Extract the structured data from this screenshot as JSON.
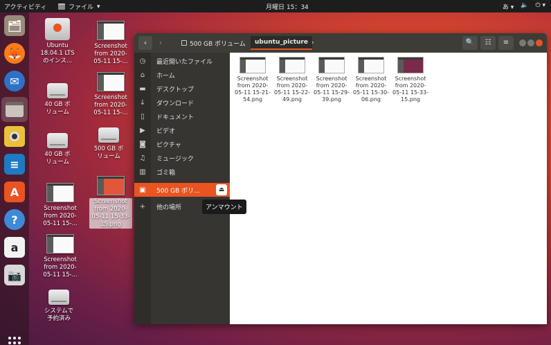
{
  "topbar": {
    "activities": "アクティビティ",
    "app_menu": "ファイル",
    "clock": "月曜日 15：34",
    "input_method": "あ",
    "volume_icon": "volume-icon",
    "power_icon": "power-icon"
  },
  "dock": {
    "items": [
      "files-icon",
      "firefox-icon",
      "thunderbird-icon",
      "nautilus-icon",
      "rhythmbox-icon",
      "writer-icon",
      "software-icon",
      "help-icon",
      "amazon-icon",
      "screenshot-icon"
    ]
  },
  "desktop": {
    "icons": [
      {
        "label": "Ubuntu\n18.04.1 LTS\nのインス..."
      },
      {
        "label": "40 GB ボ\nリューム"
      },
      {
        "label": "40 GB ボ\nリューム"
      },
      {
        "label": "Screenshot\nfrom 2020-\n05-11 15-..."
      },
      {
        "label": "Screenshot\nfrom 2020-\n05-11 15-..."
      },
      {
        "label": "システムで\n予約済み"
      },
      {
        "label": "Screenshot\nfrom 2020-\n05-11 15-..."
      },
      {
        "label": "Screenshot\nfrom 2020-\n05-11 15-..."
      },
      {
        "label": "500 GB ボ\nリューム"
      },
      {
        "label": "Screenshot\nfrom 2020-\n05-11 15-33-\n15.png"
      }
    ]
  },
  "window": {
    "breadcrumb": {
      "volume": "500 GB ボリューム",
      "folder": "ubuntu_picture"
    },
    "sidebar": {
      "items": [
        {
          "label": "最近開いたファイル",
          "icon": "clock-icon"
        },
        {
          "label": "ホーム",
          "icon": "home-icon"
        },
        {
          "label": "デスクトップ",
          "icon": "folder-icon"
        },
        {
          "label": "ダウンロード",
          "icon": "download-icon"
        },
        {
          "label": "ドキュメント",
          "icon": "document-icon"
        },
        {
          "label": "ビデオ",
          "icon": "video-icon"
        },
        {
          "label": "ピクチャ",
          "icon": "camera-icon"
        },
        {
          "label": "ミュージック",
          "icon": "music-icon"
        },
        {
          "label": "ゴミ箱",
          "icon": "trash-icon"
        },
        {
          "label": "500 GB ボリ...",
          "icon": "drive-icon"
        },
        {
          "label": "他の場所",
          "icon": "plus-icon"
        }
      ],
      "tooltip": "アンマウント"
    },
    "files": [
      {
        "name": "Screenshot\nfrom 2020-\n05-11 15-21-\n54.png"
      },
      {
        "name": "Screenshot\nfrom 2020-\n05-11 15-22-\n49.png"
      },
      {
        "name": "Screenshot\nfrom 2020-\n05-11 15-29-\n39.png"
      },
      {
        "name": "Screenshot\nfrom 2020-\n05-11 15-30-\n06.png"
      },
      {
        "name": "Screenshot\nfrom 2020-\n05-11 15-33-\n15.png"
      }
    ]
  },
  "colors": {
    "accent": "#e95420",
    "header": "#3d3c37",
    "sidebar": "#363532"
  }
}
